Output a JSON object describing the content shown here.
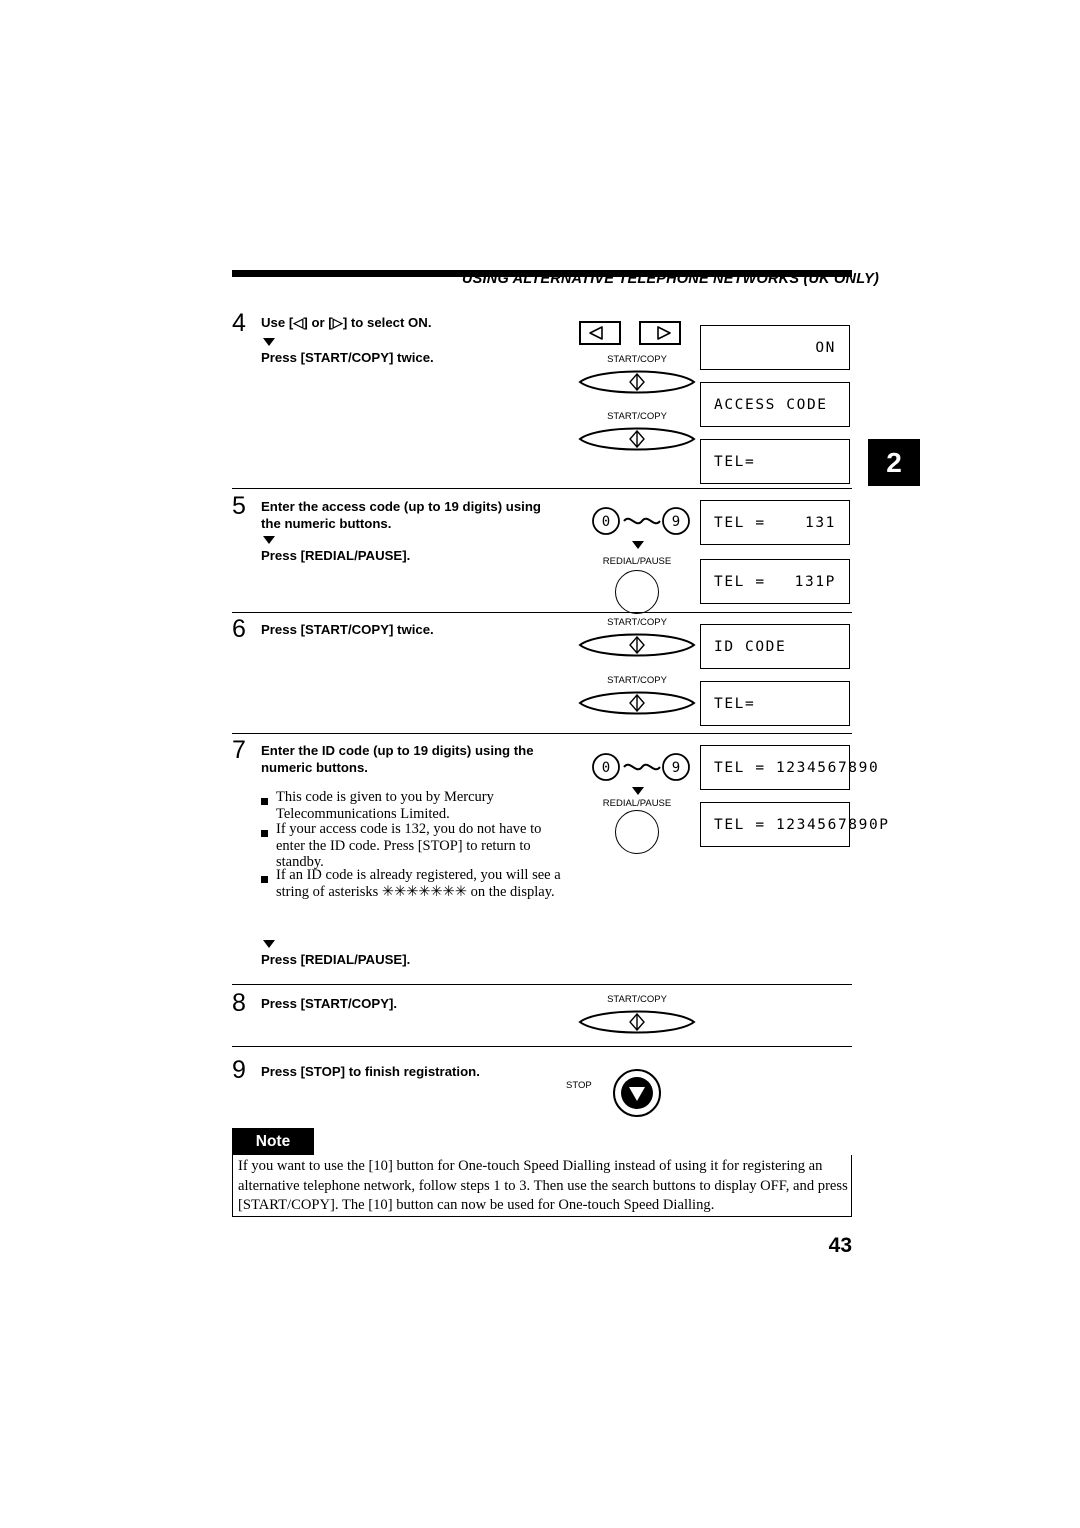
{
  "header": {
    "title": "USING ALTERNATIVE TELEPHONE NETWORKS (UK ONLY)",
    "chapter_tab": "2"
  },
  "steps": [
    {
      "num": "4",
      "line1": "Use [◁] or [▷] to select ON.",
      "line2": "Press [START/COPY] twice."
    },
    {
      "num": "5",
      "line1": "Enter the access code (up to 19 digits) using",
      "line2": "the numeric buttons.",
      "line3": "Press [REDIAL/PAUSE]."
    },
    {
      "num": "6",
      "line1": "Press [START/COPY] twice."
    },
    {
      "num": "7",
      "line1": "Enter the ID code (up to 19 digits) using the",
      "line2": "numeric buttons.",
      "bullets": [
        "This code is given to you by Mercury Telecommunications Limited.",
        "If your access code is 132, you do not have to enter the ID code. Press [STOP] to return to standby.",
        "If an ID code is already registered, you will see a string of asterisks ✳✳✳✳✳✳✳ on the display."
      ],
      "after": "Press [REDIAL/PAUSE]."
    },
    {
      "num": "8",
      "line1": "Press [START/COPY]."
    },
    {
      "num": "9",
      "line1": "Press [STOP] to finish registration."
    }
  ],
  "key_labels": {
    "start_copy": "START/COPY",
    "redial_pause": "REDIAL/PAUSE",
    "stop": "STOP"
  },
  "numpad": {
    "low": "0",
    "high": "9"
  },
  "displays": [
    {
      "id": "d1",
      "left": "",
      "right": "ON"
    },
    {
      "id": "d2",
      "left": "ACCESS CODE",
      "right": ""
    },
    {
      "id": "d3",
      "left": "TEL=",
      "right": ""
    },
    {
      "id": "d4",
      "left": "TEL =",
      "right": "131"
    },
    {
      "id": "d5",
      "left": "TEL =",
      "right": "131P"
    },
    {
      "id": "d6",
      "left": "ID CODE",
      "right": ""
    },
    {
      "id": "d7",
      "left": "TEL=",
      "right": ""
    },
    {
      "id": "d8",
      "left": "TEL = 1234567890",
      "right": ""
    },
    {
      "id": "d9",
      "left": "TEL = 1234567890P",
      "right": ""
    }
  ],
  "note": {
    "tab_label": "Note",
    "body": "If you want to use the [10] button for One-touch Speed Dialling instead of using it for registering an alternative telephone network, follow steps 1 to 3. Then use the search buttons to display OFF, and press [START/COPY]. The [10] button can now be used for One-touch Speed Dialling."
  },
  "page_number": "43"
}
